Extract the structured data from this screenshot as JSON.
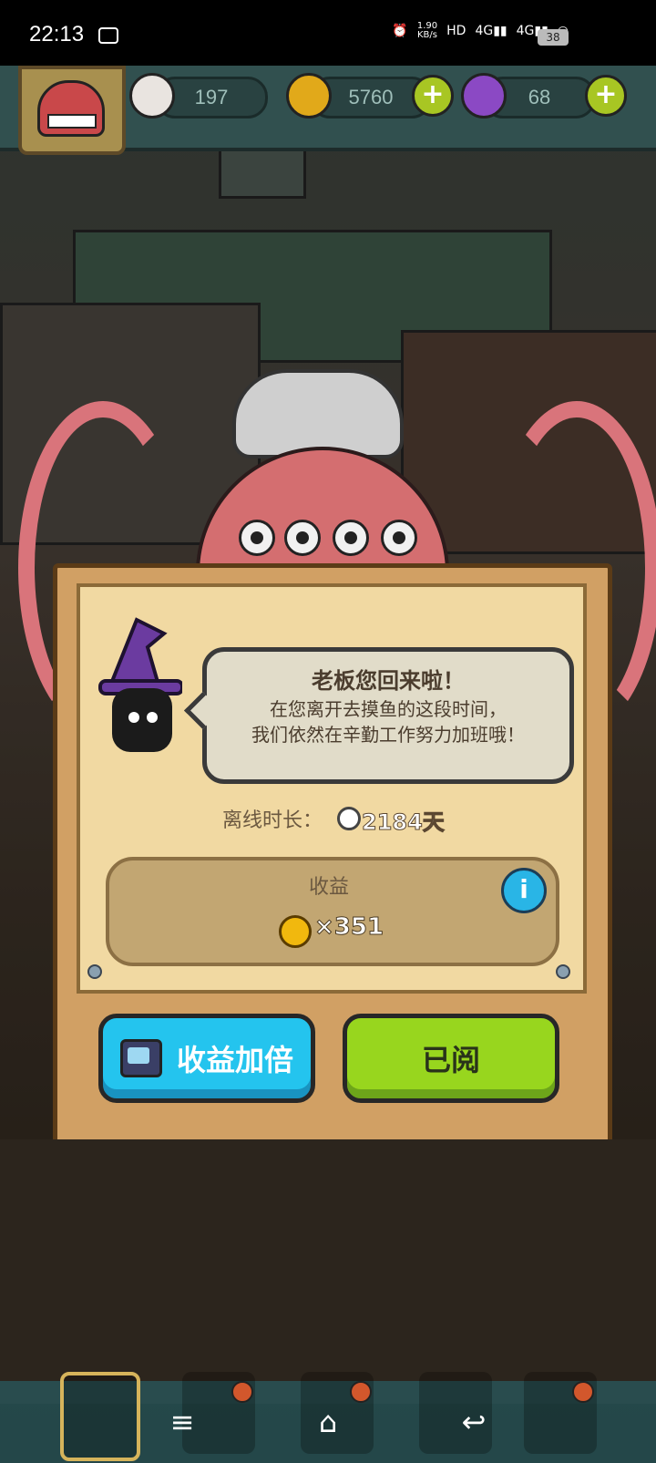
{
  "status_bar": {
    "time": "22:13",
    "net_speed": "1.90",
    "net_unit": "KB/s",
    "battery": "38"
  },
  "hud": {
    "eyeball_count": "197",
    "coin_count": "5760",
    "potion_count": "68"
  },
  "dialog": {
    "bubble_title": "老板您回来啦！",
    "bubble_line1": "在您离开去摸鱼的这段时间，",
    "bubble_line2": "我们依然在辛勤工作努力加班哦！",
    "offline_label": "离线时长：",
    "offline_value": "2184天",
    "income_label": "收益",
    "income_value": "×351",
    "info_glyph": "i",
    "double_button": "收益加倍",
    "read_button": "已阅"
  },
  "colors": {
    "blue_button": "#24c4ee",
    "green_button": "#98d61e",
    "panel": "#d1a064",
    "paper": "#f1d9a2"
  },
  "icons": [
    "eyeball-icon",
    "coin-icon",
    "potion-icon",
    "plus-icon",
    "clock-icon",
    "info-icon",
    "tv-icon",
    "menu-icon",
    "home-icon",
    "back-icon"
  ],
  "nav": {
    "menu_glyph": "≡",
    "home_glyph": "⌂",
    "back_glyph": "↩"
  }
}
